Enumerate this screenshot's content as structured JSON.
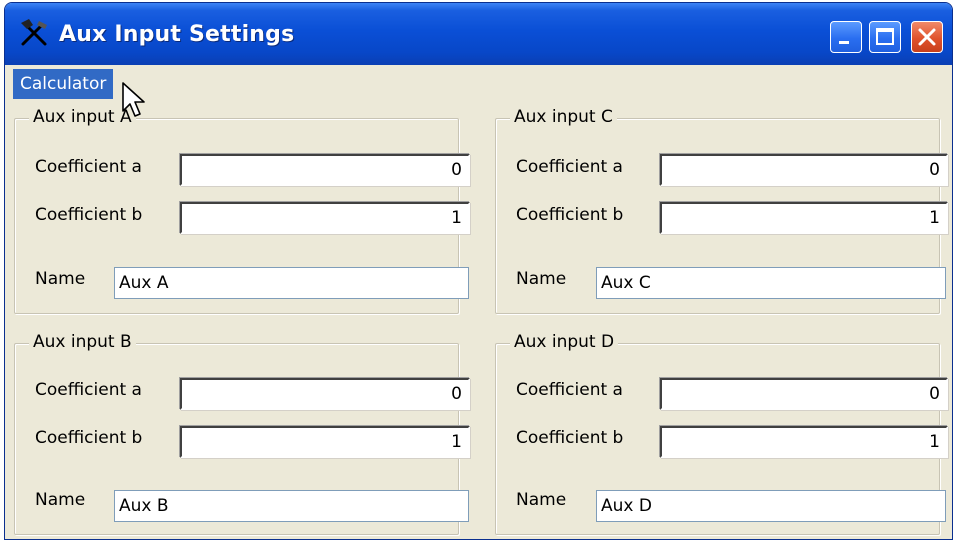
{
  "window": {
    "title": "Aux Input Settings",
    "title_icon": "tools-icon",
    "buttons": [
      "minimize-icon",
      "maximize-icon",
      "close-icon"
    ]
  },
  "menu": {
    "items": [
      {
        "label": "Calculator"
      }
    ]
  },
  "groups": {
    "a": {
      "legend": "Aux input A",
      "coef_a_label": "Coefficient a",
      "coef_a": "0",
      "coef_b_label": "Coefficient b",
      "coef_b": "1",
      "name_label": "Name",
      "name": "Aux A"
    },
    "c": {
      "legend": "Aux input C",
      "coef_a_label": "Coefficient a",
      "coef_a": "0",
      "coef_b_label": "Coefficient b",
      "coef_b": "1",
      "name_label": "Name",
      "name": "Aux C"
    },
    "b": {
      "legend": "Aux input B",
      "coef_a_label": "Coefficient a",
      "coef_a": "0",
      "coef_b_label": "Coefficient b",
      "coef_b": "1",
      "name_label": "Name",
      "name": "Aux B"
    },
    "d": {
      "legend": "Aux input D",
      "coef_a_label": "Coefficient a",
      "coef_a": "0",
      "coef_b_label": "Coefficient b",
      "coef_b": "1",
      "name_label": "Name",
      "name": "Aux D"
    }
  },
  "colors": {
    "titlebar": "#0a4fd6",
    "menu_highlight": "#316ac5",
    "dialog_bg": "#ece9d8",
    "close_button": "#e0522c"
  }
}
